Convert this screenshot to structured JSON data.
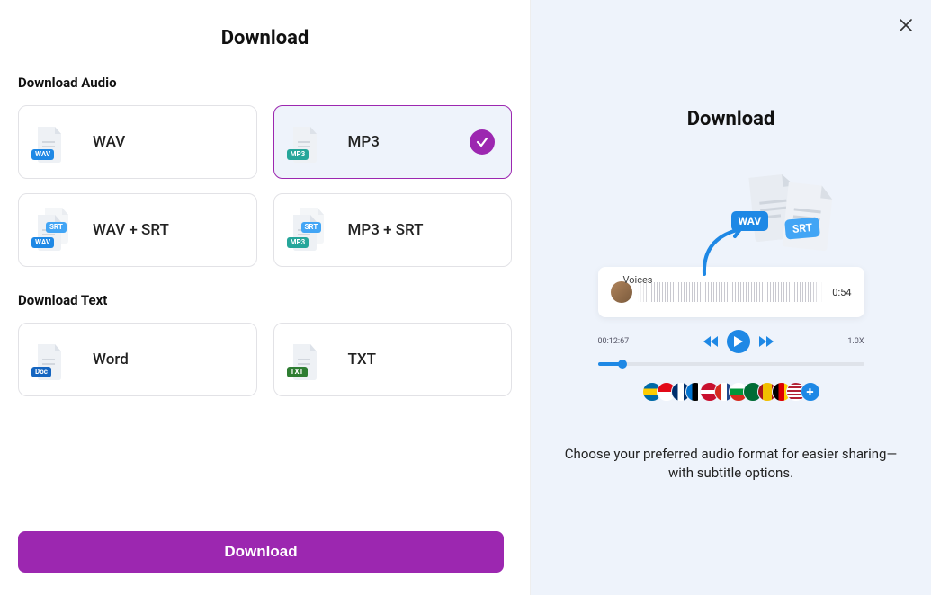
{
  "left": {
    "title": "Download",
    "audio_section": "Download Audio",
    "text_section": "Download Text",
    "download_btn": "Download",
    "options_audio": [
      {
        "label": "WAV",
        "ext": "WAV",
        "color": "#1e88e5",
        "selected": false
      },
      {
        "label": "MP3",
        "ext": "MP3",
        "color": "#26a69a",
        "selected": true
      },
      {
        "label": "WAV + SRT",
        "ext": "WAV",
        "ext2": "SRT",
        "color": "#1e88e5",
        "color2": "#42a5f5",
        "selected": false
      },
      {
        "label": "MP3 + SRT",
        "ext": "MP3",
        "ext2": "SRT",
        "color": "#26a69a",
        "color2": "#42a5f5",
        "selected": false
      }
    ],
    "options_text": [
      {
        "label": "Word",
        "ext": "Doc",
        "color": "#1565c0"
      },
      {
        "label": "TXT",
        "ext": "TXT",
        "color": "#2e7d32"
      }
    ]
  },
  "right": {
    "title": "Download",
    "voices_label": "Voices",
    "voice_duration": "0:54",
    "player_time": "00:12:67",
    "player_speed": "1.0X",
    "badge_wav": "WAV",
    "badge_srt": "SRT",
    "desc": "Choose your preferred audio format for easier sharing—with subtitle options."
  },
  "flag_colors": [
    "linear-gradient(180deg,#006aa7 33%,#fecc00 33% 66%,#006aa7 66%)",
    "linear-gradient(180deg,#e30a17 50%,#fff 50%)",
    "linear-gradient(90deg,#002f6c 33%,#fff 33% 66%,#002f6c 66%)",
    "linear-gradient(90deg,#0072ce 33%,#000 33% 66%,#fff 66%)",
    "linear-gradient(180deg,#c8102e 40%,#fff 40% 60%,#c8102e 60%)",
    "linear-gradient(90deg,#d52b1e 33%,#fff 33% 66%,#21468b 66%)",
    "linear-gradient(180deg,#fff 33%,#009639 33% 66%,#d52b1e 66%)",
    "linear-gradient(180deg,#006c35 100%,#006c35 0)",
    "linear-gradient(90deg,#aa151b 25%,#f1bf00 25% 75%,#aa151b 75%)",
    "linear-gradient(90deg,#000 33%,#dd0000 33% 66%,#ffce00 66%)",
    "repeating-linear-gradient(180deg,#b22234 0 2px,#fff 2px 4px)"
  ]
}
